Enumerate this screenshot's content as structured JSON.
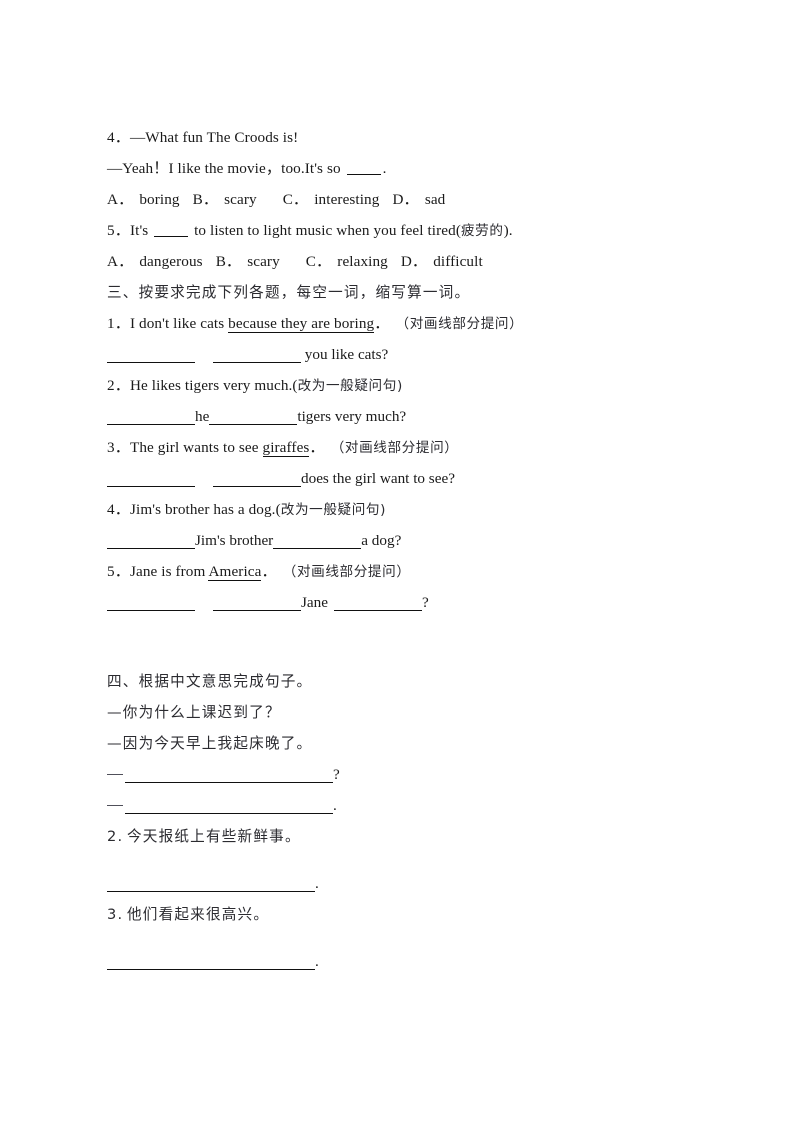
{
  "document": {
    "type": "worksheet",
    "language": "en-zh",
    "page_background": "#ffffff",
    "text_color": "#1a1a1a"
  },
  "multiple_choice": {
    "items": [
      {
        "number": "4．",
        "prompt_lines": [
          "—What fun The Croods is!",
          "—Yeah！I like the movie，too.It's so ____."
        ],
        "stem_a": "—What fun The Croods is!",
        "stem_b_pre": "—Yeah！I like the movie，too.It's so ",
        "stem_b_post": ".",
        "options": [
          {
            "letter": "A．",
            "text": "boring"
          },
          {
            "letter": "B．",
            "text": "scary"
          },
          {
            "letter": "C．",
            "text": "interesting"
          },
          {
            "letter": "D．",
            "text": "sad"
          }
        ]
      },
      {
        "number": "5．",
        "stem_pre": "It's ",
        "stem_post": " to listen to light music when you feel tired(",
        "stem_cn": "疲劳的",
        "stem_end": ").",
        "options": [
          {
            "letter": "A．",
            "text": "dangerous"
          },
          {
            "letter": "B．",
            "text": "scary"
          },
          {
            "letter": "C．",
            "text": "relaxing"
          },
          {
            "letter": "D．",
            "text": "difficult"
          }
        ]
      }
    ]
  },
  "section_three": {
    "heading": "三、按要求完成下列各题，每空一词，缩写算一词。",
    "items": [
      {
        "number": "1．",
        "sentence_pre": "I don't like cats ",
        "sentence_underlined": "because they are boring",
        "sentence_post": "．",
        "instruction": "（对画线部分提问）",
        "answer_tail": " you like cats?",
        "answer_mid": "",
        "blanks": 2
      },
      {
        "number": "2．",
        "sentence_pre": "He likes tigers very much.(",
        "sentence_underlined": "",
        "sentence_post": "",
        "instruction": "改为一般疑问句)",
        "answer_mid": "he",
        "answer_tail": "tigers very much?",
        "blanks": 2
      },
      {
        "number": "3．",
        "sentence_pre": "The girl wants to see ",
        "sentence_underlined": "giraffes",
        "sentence_post": "．",
        "instruction": "（对画线部分提问）",
        "answer_mid": "",
        "answer_tail": "does the girl want to see?",
        "blanks": 2
      },
      {
        "number": "4．",
        "sentence_pre": "Jim's brother has a dog.(",
        "sentence_underlined": "",
        "sentence_post": "",
        "instruction": "改为一般疑问句)",
        "answer_mid": "Jim's brother",
        "answer_tail": "a dog?",
        "blanks": 2
      },
      {
        "number": "5．",
        "sentence_pre": "Jane is from ",
        "sentence_underlined": "America",
        "sentence_post": "．",
        "instruction": "（对画线部分提问）",
        "answer_mid": "Jane",
        "answer_tail": "?",
        "blanks": 3
      }
    ]
  },
  "section_four": {
    "heading": "四、根据中文意思完成句子。",
    "items": [
      {
        "number": "",
        "cn_lines": [
          "—你为什么上课迟到了？",
          "—因为今天早上我起床晚了。"
        ],
        "answer_lines": [
          {
            "lead": "—",
            "terminator": "?"
          },
          {
            "lead": "—",
            "terminator": "."
          }
        ]
      },
      {
        "number": "2.",
        "cn_lines": [
          "今天报纸上有些新鲜事。"
        ],
        "answer_lines": [
          {
            "lead": "",
            "terminator": "."
          }
        ]
      },
      {
        "number": "3.",
        "cn_lines": [
          "他们看起来很高兴。"
        ],
        "answer_lines": [
          {
            "lead": "",
            "terminator": "."
          }
        ]
      }
    ]
  }
}
